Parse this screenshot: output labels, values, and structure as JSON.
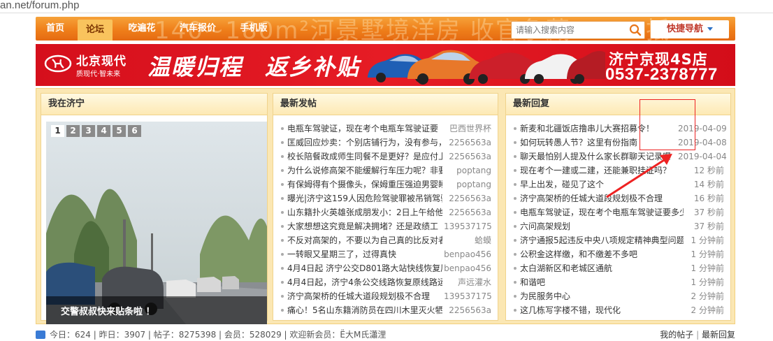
{
  "browser": {
    "url": "an.net/forum.php"
  },
  "topnav": {
    "ghost_text": "140~180m²河景墅境洋房 收官争藏 1500抵",
    "items": [
      {
        "label": "首页"
      },
      {
        "label": "论坛"
      },
      {
        "label": "吃遍花"
      },
      {
        "label": "汽车报价"
      },
      {
        "label": "手机版"
      }
    ],
    "search_placeholder": "请输入搜索内容",
    "quick_nav_label": "快捷导航"
  },
  "banner": {
    "brand": "北京现代",
    "slogan": "质现代·智未来",
    "callig_1": "温暖归程",
    "callig_2": "返乡补贴",
    "dealer": "济宁京现4S店",
    "phone": "0537-2378777"
  },
  "panels": {
    "jining": {
      "title": "我在济宁",
      "tabs": [
        "1",
        "2",
        "3",
        "4",
        "5",
        "6"
      ],
      "active_tab": 0,
      "caption": "交警叔叔快来贴条啦 ！"
    },
    "new_posts": {
      "title": "最新发帖",
      "rows": [
        {
          "title": "电瓶车驾驶证，现在考个电瓶车驾驶证要",
          "author": "巴西世界杯"
        },
        {
          "title": "匡威回应炒卖：个别店铺行为，没有参与，",
          "author": "2256563a"
        },
        {
          "title": "校长陪餐政成师生同餐不是更好？是应付上",
          "author": "2256563a"
        },
        {
          "title": "为什么说修高架不能缓解行车压力呢？非要去",
          "author": "poptang"
        },
        {
          "title": "有保姆得有个摄像头，保姆重压强迫男婴睡觉",
          "author": "poptang"
        },
        {
          "title": "曝光|济宁这159人因危险驾驶罪被吊销驾驶",
          "author": "2256563a"
        },
        {
          "title": "山东籍扑火英雄张成朋发小：2日上午给他",
          "author": "2256563a"
        },
        {
          "title": "大家想想这究竟是解决拥堵？还是政绩工",
          "author": "1395371758"
        },
        {
          "title": "不反对高架的，不要以为自己真的比反对者高",
          "author": "蛤蟆"
        },
        {
          "title": "一转眼又星期三了，过得真快",
          "author": "benpao456"
        },
        {
          "title": "4月4日起 济宁公交D801路大站快线恢复原",
          "author": "benpao456"
        },
        {
          "title": "4月4日起，济宁4条公交线路恢复原线路运营",
          "author": "声远灌水"
        },
        {
          "title": "济宁高架桥的任城大道段规划极不合理",
          "author": "1395371758"
        },
        {
          "title": "痛心！5名山东籍消防员在四川木里灭火牺",
          "author": "2256563a"
        }
      ]
    },
    "new_replies": {
      "title": "最新回复",
      "rows": [
        {
          "title": "新麦和北疆饭店撸串儿大赛招募令！",
          "time": "2019-04-09"
        },
        {
          "title": "如何玩转愚人节？这里有份指南",
          "time": "2019-04-08"
        },
        {
          "title": "聊天最怕别人提及什么家长群聊天记录曝",
          "time": "2019-04-04"
        },
        {
          "title": "现在考个一建或二建，还能兼职挂证吗？",
          "time": "12 秒前"
        },
        {
          "title": "早上出发，碰见了这个",
          "time": "14 秒前"
        },
        {
          "title": "济宁高架桥的任城大道段规划极不合理",
          "time": "16 秒前"
        },
        {
          "title": "电瓶车驾驶证，现在考个电瓶车驾驶证要多少",
          "time": "37 秒前"
        },
        {
          "title": "六问高架规划",
          "time": "37 秒前"
        },
        {
          "title": "济宁通报5起违反中央八项规定精神典型问题",
          "time": "1 分钟前"
        },
        {
          "title": "公积金这样缴，和不缴差不多吧",
          "time": "1 分钟前"
        },
        {
          "title": "太白湖新区和老城区通航",
          "time": "1 分钟前"
        },
        {
          "title": "和谐吧",
          "time": "1 分钟前"
        },
        {
          "title": "为民服务中心",
          "time": "2 分钟前"
        },
        {
          "title": "这几栋写字楼不错，现代化",
          "time": "2 分钟前"
        }
      ]
    }
  },
  "stats": {
    "text": "今日：624 | 昨日：3907 | 帖子：8275398 | 会员：528029 | 欢迎新会员：Ё大M氏瀟浬",
    "my_posts": "我的帖子",
    "latest_reply": "最新回复"
  },
  "colors": {
    "nav_orange": "#ef7f1a",
    "banner_red": "#e61c25",
    "panel_bg": "#fbe7b3",
    "annotation_red": "#ee2222"
  }
}
